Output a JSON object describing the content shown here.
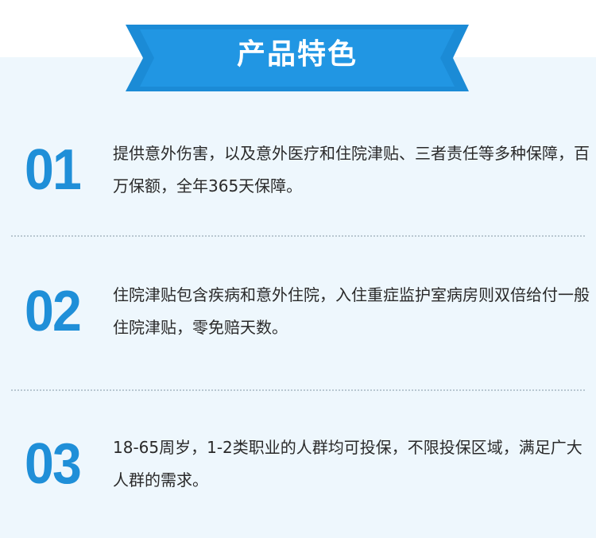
{
  "banner": {
    "title": "产品特色"
  },
  "colors": {
    "accent": "#1f8fd8",
    "banner_fill": "#1b8bd6",
    "panel_bg": "#eef7fd",
    "text": "#2a2a2a"
  },
  "features": [
    {
      "number": "01",
      "text": "提供意外伤害，以及意外医疗和住院津贴、三者责任等多种保障，百万保额，全年365天保障。"
    },
    {
      "number": "02",
      "text": "住院津贴包含疾病和意外住院，入住重症监护室病房则双倍给付一般住院津贴，零免赔天数。"
    },
    {
      "number": "03",
      "text": "18-65周岁，1-2类职业的人群均可投保，不限投保区域，满足广大人群的需求。"
    }
  ]
}
